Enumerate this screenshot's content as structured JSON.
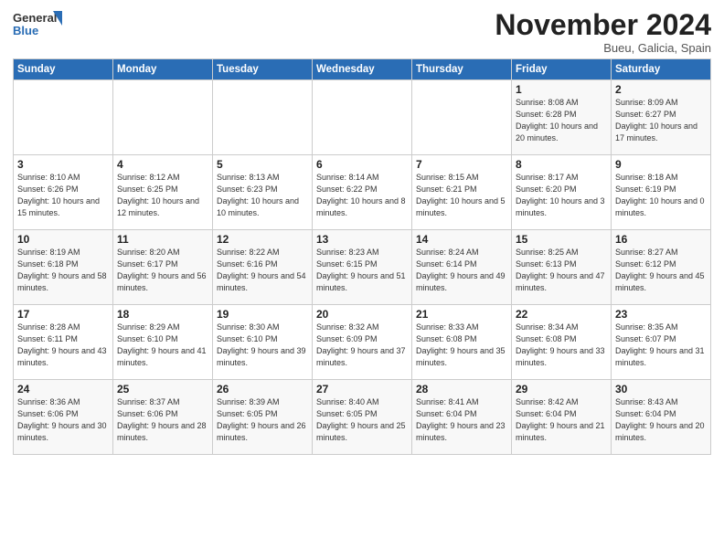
{
  "logo": {
    "line1": "General",
    "line2": "Blue"
  },
  "title": "November 2024",
  "location": "Bueu, Galicia, Spain",
  "weekdays": [
    "Sunday",
    "Monday",
    "Tuesday",
    "Wednesday",
    "Thursday",
    "Friday",
    "Saturday"
  ],
  "weeks": [
    [
      {
        "day": "",
        "info": ""
      },
      {
        "day": "",
        "info": ""
      },
      {
        "day": "",
        "info": ""
      },
      {
        "day": "",
        "info": ""
      },
      {
        "day": "",
        "info": ""
      },
      {
        "day": "1",
        "info": "Sunrise: 8:08 AM\nSunset: 6:28 PM\nDaylight: 10 hours and 20 minutes."
      },
      {
        "day": "2",
        "info": "Sunrise: 8:09 AM\nSunset: 6:27 PM\nDaylight: 10 hours and 17 minutes."
      }
    ],
    [
      {
        "day": "3",
        "info": "Sunrise: 8:10 AM\nSunset: 6:26 PM\nDaylight: 10 hours and 15 minutes."
      },
      {
        "day": "4",
        "info": "Sunrise: 8:12 AM\nSunset: 6:25 PM\nDaylight: 10 hours and 12 minutes."
      },
      {
        "day": "5",
        "info": "Sunrise: 8:13 AM\nSunset: 6:23 PM\nDaylight: 10 hours and 10 minutes."
      },
      {
        "day": "6",
        "info": "Sunrise: 8:14 AM\nSunset: 6:22 PM\nDaylight: 10 hours and 8 minutes."
      },
      {
        "day": "7",
        "info": "Sunrise: 8:15 AM\nSunset: 6:21 PM\nDaylight: 10 hours and 5 minutes."
      },
      {
        "day": "8",
        "info": "Sunrise: 8:17 AM\nSunset: 6:20 PM\nDaylight: 10 hours and 3 minutes."
      },
      {
        "day": "9",
        "info": "Sunrise: 8:18 AM\nSunset: 6:19 PM\nDaylight: 10 hours and 0 minutes."
      }
    ],
    [
      {
        "day": "10",
        "info": "Sunrise: 8:19 AM\nSunset: 6:18 PM\nDaylight: 9 hours and 58 minutes."
      },
      {
        "day": "11",
        "info": "Sunrise: 8:20 AM\nSunset: 6:17 PM\nDaylight: 9 hours and 56 minutes."
      },
      {
        "day": "12",
        "info": "Sunrise: 8:22 AM\nSunset: 6:16 PM\nDaylight: 9 hours and 54 minutes."
      },
      {
        "day": "13",
        "info": "Sunrise: 8:23 AM\nSunset: 6:15 PM\nDaylight: 9 hours and 51 minutes."
      },
      {
        "day": "14",
        "info": "Sunrise: 8:24 AM\nSunset: 6:14 PM\nDaylight: 9 hours and 49 minutes."
      },
      {
        "day": "15",
        "info": "Sunrise: 8:25 AM\nSunset: 6:13 PM\nDaylight: 9 hours and 47 minutes."
      },
      {
        "day": "16",
        "info": "Sunrise: 8:27 AM\nSunset: 6:12 PM\nDaylight: 9 hours and 45 minutes."
      }
    ],
    [
      {
        "day": "17",
        "info": "Sunrise: 8:28 AM\nSunset: 6:11 PM\nDaylight: 9 hours and 43 minutes."
      },
      {
        "day": "18",
        "info": "Sunrise: 8:29 AM\nSunset: 6:10 PM\nDaylight: 9 hours and 41 minutes."
      },
      {
        "day": "19",
        "info": "Sunrise: 8:30 AM\nSunset: 6:10 PM\nDaylight: 9 hours and 39 minutes."
      },
      {
        "day": "20",
        "info": "Sunrise: 8:32 AM\nSunset: 6:09 PM\nDaylight: 9 hours and 37 minutes."
      },
      {
        "day": "21",
        "info": "Sunrise: 8:33 AM\nSunset: 6:08 PM\nDaylight: 9 hours and 35 minutes."
      },
      {
        "day": "22",
        "info": "Sunrise: 8:34 AM\nSunset: 6:08 PM\nDaylight: 9 hours and 33 minutes."
      },
      {
        "day": "23",
        "info": "Sunrise: 8:35 AM\nSunset: 6:07 PM\nDaylight: 9 hours and 31 minutes."
      }
    ],
    [
      {
        "day": "24",
        "info": "Sunrise: 8:36 AM\nSunset: 6:06 PM\nDaylight: 9 hours and 30 minutes."
      },
      {
        "day": "25",
        "info": "Sunrise: 8:37 AM\nSunset: 6:06 PM\nDaylight: 9 hours and 28 minutes."
      },
      {
        "day": "26",
        "info": "Sunrise: 8:39 AM\nSunset: 6:05 PM\nDaylight: 9 hours and 26 minutes."
      },
      {
        "day": "27",
        "info": "Sunrise: 8:40 AM\nSunset: 6:05 PM\nDaylight: 9 hours and 25 minutes."
      },
      {
        "day": "28",
        "info": "Sunrise: 8:41 AM\nSunset: 6:04 PM\nDaylight: 9 hours and 23 minutes."
      },
      {
        "day": "29",
        "info": "Sunrise: 8:42 AM\nSunset: 6:04 PM\nDaylight: 9 hours and 21 minutes."
      },
      {
        "day": "30",
        "info": "Sunrise: 8:43 AM\nSunset: 6:04 PM\nDaylight: 9 hours and 20 minutes."
      }
    ]
  ]
}
